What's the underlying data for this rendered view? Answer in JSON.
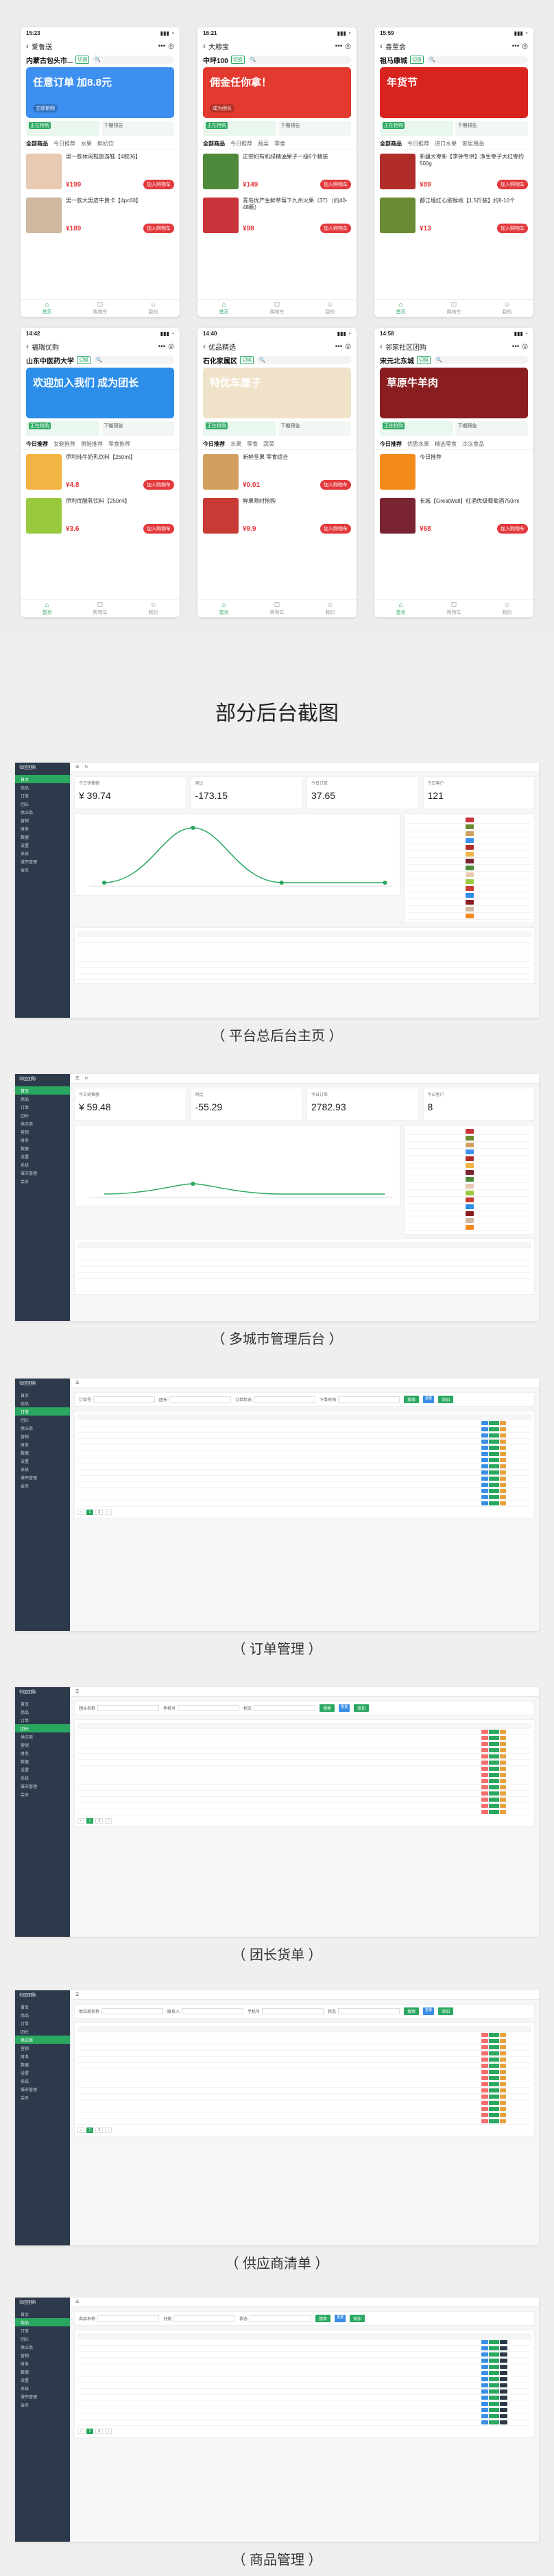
{
  "phones": [
    {
      "status_time": "15:23",
      "title": "爱鲁送",
      "city": "内蒙古包头市...",
      "banner_text": "任意订单\n加8.8元",
      "banner_sub": "立即抢购",
      "banner_color": "#3d8ff0",
      "promo": [
        "正在抢购",
        "下期预告"
      ],
      "tabs": [
        "全部商品",
        "今日推荐",
        "水果",
        "鲜奶饮"
      ],
      "products": [
        {
          "name": "男一款休闲鞋旅游鞋【4款36】",
          "price": "¥199",
          "img": "#e8c9b2"
        },
        {
          "name": "男一款大男皮牛黄卡【4pc60】",
          "price": "¥189",
          "img": "#d0b7a0"
        }
      ],
      "nav": [
        "首页",
        "购物车",
        "我的"
      ]
    },
    {
      "status_time": "16:21",
      "title": "大粮宝",
      "city": "中坪100",
      "banner_text": "佣金任你拿！",
      "banner_sub": "成为团长",
      "banner_color": "#e23a2f",
      "promo": [
        "正在抢购",
        "下期预告"
      ],
      "tabs": [
        "全部商品",
        "今日推荐",
        "蔬菜",
        "零食"
      ],
      "products": [
        {
          "name": "正宗妇有机绿精油果子一级6个精装",
          "price": "¥149",
          "img": "#4f8a3c"
        },
        {
          "name": "青岛优产生鲜草莓下九州火果（37）（约40-48颗）",
          "price": "¥98",
          "img": "#c9333a"
        }
      ],
      "nav": [
        "首页",
        "购物车",
        "我的"
      ]
    },
    {
      "status_time": "15:59",
      "title": "喜至会",
      "city": "祖马康城",
      "banner_text": "年货节",
      "banner_sub": "",
      "banner_color": "#d9231f",
      "promo": [
        "正在抢购",
        "下期预告"
      ],
      "tabs": [
        "全部商品",
        "今日推荐",
        "进口水果",
        "家居用品"
      ],
      "products": [
        {
          "name": "新疆大枣新【李钟专供】净生枣子大红枣约500g",
          "price": "¥89",
          "img": "#b12d2a"
        },
        {
          "name": "都江堰红心猕猴桃【1.5斤装】约8-10个",
          "price": "¥13",
          "img": "#6a8b32"
        }
      ],
      "nav": [
        "首页",
        "购物车",
        "我的"
      ]
    },
    {
      "status_time": "14:42",
      "title": "福瑞优购",
      "city": "山东中医药大学",
      "banner_text": "欢迎加入我们\n成为团长",
      "banner_sub": "",
      "banner_color": "#2d8ee9",
      "promo": [
        "正在抢购",
        "下期预告"
      ],
      "tabs": [
        "今日推荐",
        "女鞋推荐",
        "男鞋推荐",
        "零食推荐"
      ],
      "products": [
        {
          "name": "伊利纯牛奶乳饮料【250ml】",
          "price": "¥4.8",
          "img": "#f2b544"
        },
        {
          "name": "伊利优酸乳饮料【250ml】",
          "price": "¥3.6",
          "img": "#9ac93f"
        }
      ],
      "nav": [
        "首页",
        "购物车",
        "我的"
      ]
    },
    {
      "status_time": "14:40",
      "title": "优品精选",
      "city": "石化家属区",
      "banner_text": "特优车厘子",
      "banner_sub": "",
      "banner_color": "#f0e2c8",
      "promo": [
        "正在抢购",
        "下期预告"
      ],
      "tabs": [
        "今日推荐",
        "水果",
        "零食",
        "蔬菜"
      ],
      "products": [
        {
          "name": "新鲜坚果 零食组合",
          "price": "¥0.01",
          "img": "#d1a061"
        },
        {
          "name": "鲜果限时抢购",
          "price": "¥9.9",
          "img": "#c83a34"
        }
      ],
      "nav": [
        "首页",
        "购物车",
        "我的"
      ]
    },
    {
      "status_time": "14:58",
      "title": "邻家社区团购",
      "city": "宋元北东城",
      "banner_text": "草原牛羊肉",
      "banner_sub": "",
      "banner_color": "#8a1d20",
      "promo": [
        "正在抢购",
        "下期预告"
      ],
      "tabs": [
        "今日推荐",
        "优质水果",
        "精选零食",
        "冷冻食品"
      ],
      "products": [
        {
          "name": "今日推荐",
          "price": "",
          "img": "#f28a1c"
        },
        {
          "name": "长城【GreatWall】红酒优级葡萄酒750ml",
          "price": "¥68",
          "img": "#7a2331"
        }
      ],
      "nav": [
        "首页",
        "购物车",
        "我的"
      ]
    }
  ],
  "section_title": "部分后台截图",
  "captions": [
    "（ 平台总后台主页 ）",
    "（ 多城市管理后台 ）",
    "（ 订单管理 ）",
    "（ 团长货单 ）",
    "（ 供应商清单 ）",
    "（ 商品管理 ）"
  ],
  "admin_common": {
    "brand": "社区团购",
    "menu": [
      "首页",
      "商品",
      "订单",
      "团长",
      "供应商",
      "营销",
      "财务",
      "数据",
      "设置",
      "系统",
      "城市管理",
      "会员"
    ]
  },
  "dashboard1": {
    "stats": [
      {
        "label": "今日销售额",
        "value": "¥ 39.74"
      },
      {
        "label": "同比",
        "value": "-173.15"
      },
      {
        "label": "今日订单",
        "value": "37.65"
      },
      {
        "label": "今日客户",
        "value": "121"
      }
    ]
  },
  "dashboard2": {
    "stats": [
      {
        "label": "今日销售额",
        "value": "¥ 59.48"
      },
      {
        "label": "同比",
        "value": "-55.29"
      },
      {
        "label": "今日订单",
        "value": "2782.93"
      },
      {
        "label": "今日客户",
        "value": "8"
      }
    ]
  },
  "filters": {
    "order": [
      "订单号",
      "团长",
      "订单状态",
      "下单时间"
    ],
    "head": [
      "团长名称",
      "手机号",
      "状态"
    ],
    "supplier": [
      "供应商名称",
      "联系人",
      "手机号",
      "状态"
    ],
    "goods": [
      "商品名称",
      "分类",
      "状态"
    ],
    "search": "搜索",
    "reset": "重置",
    "add": "添加"
  }
}
